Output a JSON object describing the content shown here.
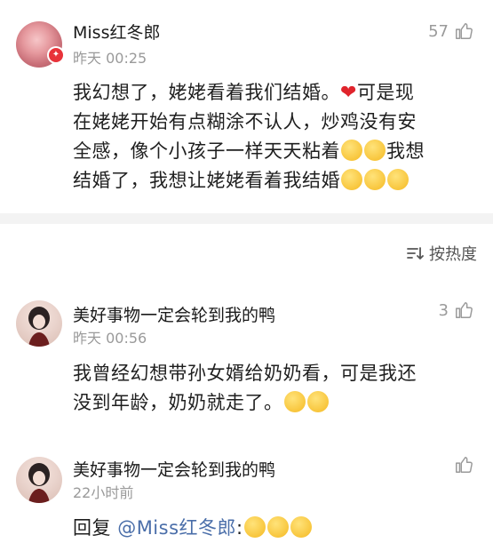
{
  "comments": [
    {
      "name": "Miss红冬郎",
      "time": "昨天 00:25",
      "likes": "57",
      "lines": [
        "我幻想了，姥姥看着我们结婚。",
        "可是现",
        "在姥姥开始有点糊涂不认人，炒鸡没有安",
        "全感，像个小孩子一样天天粘着",
        "我想",
        "结婚了，我想让姥姥看着我结婚"
      ]
    },
    {
      "name": "美好事物一定会轮到我的鸭",
      "time": "昨天 00:56",
      "likes": "3",
      "lines": [
        "我曾经幻想带孙女婿给奶奶看，可是我还",
        "没到年龄，奶奶就走了。"
      ]
    },
    {
      "name": "美好事物一定会轮到我的鸭",
      "time": "22小时前",
      "likes": "",
      "reply_prefix": "回复 ",
      "mention": "@Miss红冬郎",
      "reply_suffix": ":"
    }
  ],
  "sort": {
    "label": "按热度",
    "icon": "sort-icon"
  },
  "icons": {
    "like": "thumbs-up-icon",
    "heart": "heart-icon",
    "badge": "verified-badge-icon"
  },
  "colors": {
    "mention": "#4a6ea9",
    "heart": "#e0242c",
    "badge": "#e8333a"
  }
}
